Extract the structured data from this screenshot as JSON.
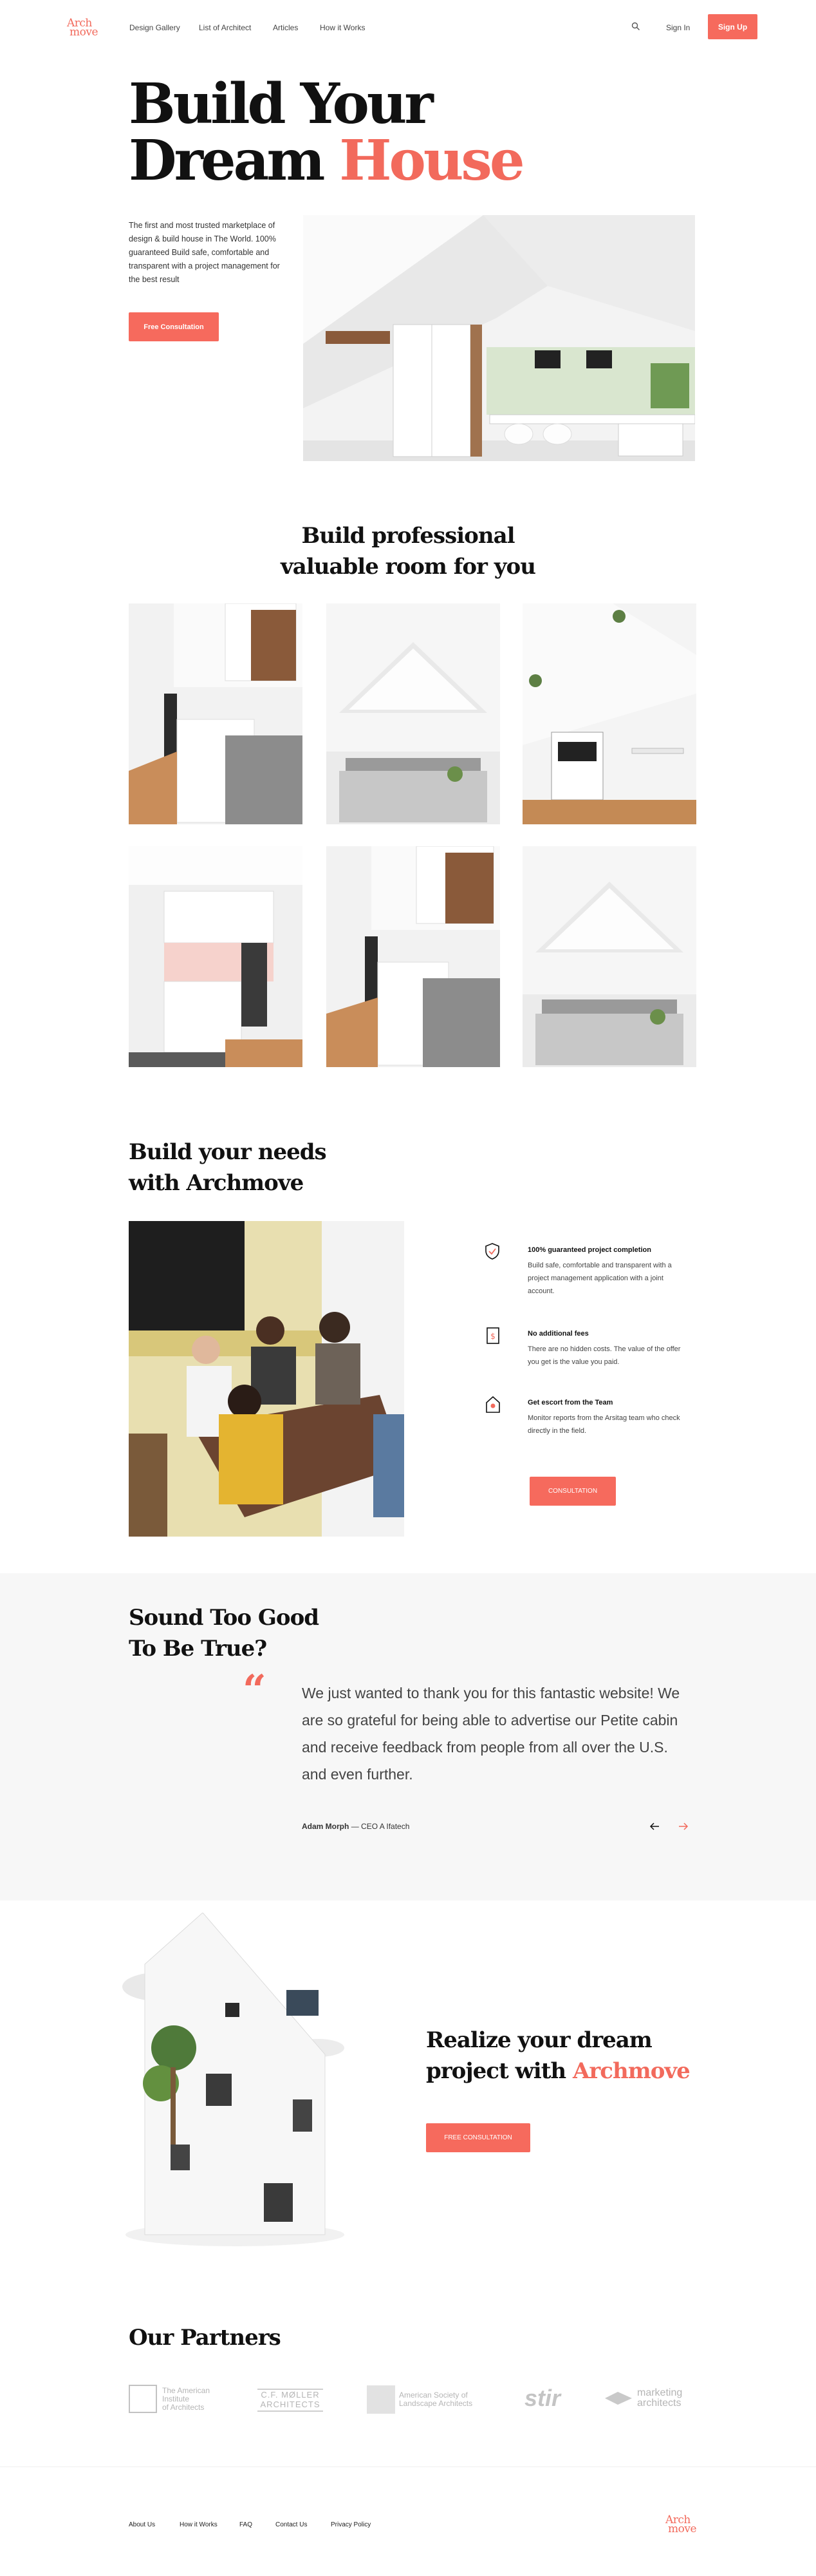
{
  "brand": {
    "logo_line1": "Arch",
    "logo_line2": "move",
    "accent_color": "#f26a5c",
    "button_color": "#f66a5d"
  },
  "nav": {
    "links": [
      "Design Gallery",
      "List of Architect",
      "Articles",
      "How it Works"
    ],
    "search_icon": "search-icon",
    "signin": "Sign In",
    "signup": "Sign Up"
  },
  "hero": {
    "title_line1": "Build Your",
    "title_line2_plain": "Dream",
    "title_line2_accent": "House",
    "description": "The first and most trusted marketplace of design & build house in The World. 100% guaranteed Build safe, comfortable and transparent with a project management for the best result",
    "cta": "Free Consultation"
  },
  "gallery": {
    "title_line1": "Build professional",
    "title_line2": "valuable room for you"
  },
  "needs": {
    "title_line1": "Build your needs",
    "title_line2": "with Archmove",
    "features": [
      {
        "icon": "shield-check-icon",
        "title": "100% guaranteed project completion",
        "text": "Build safe, comfortable and transparent with a project management application with a joint account."
      },
      {
        "icon": "price-tag-icon",
        "title": "No additional fees",
        "text": "There are no hidden costs. The value of the offer you get is the value you paid."
      },
      {
        "icon": "house-pin-icon",
        "title": "Get escort from the Team",
        "text": "Monitor reports from the Arsitag team who check directly in the field."
      }
    ],
    "cta": "CONSULTATION"
  },
  "testimonial": {
    "title_line1": "Sound Too Good",
    "title_line2": "To Be True?",
    "quote_icon": "quote-icon",
    "quote": "We just wanted to thank you for this fantastic website! We are so grateful for being able to advertise our Petite cabin and receive feedback from people from all over the U.S. and even further.",
    "author": "Adam Morph",
    "role": "— CEO A Ifatech",
    "prev_icon": "arrow-left-icon",
    "next_icon": "arrow-right-icon"
  },
  "realize": {
    "title_line1": "Realize your dream",
    "title_line2_plain": "project with",
    "title_line2_accent": "Archmove",
    "cta": "FREE CONSULTATION"
  },
  "partners": {
    "title": "Our Partners",
    "items": [
      {
        "line1": "The American",
        "line2": "Institute",
        "line3": "of Architects"
      },
      {
        "line1": "C.F. MØLLER",
        "line2": "ARCHITECTS"
      },
      {
        "line1": "American Society of",
        "line2": "Landscape Architects"
      },
      {
        "line1": "stir"
      },
      {
        "line1": "marketing",
        "line2": "architects"
      }
    ]
  },
  "footer": {
    "links": [
      "About Us",
      "How it Works",
      "FAQ",
      "Contact Us",
      "Privacy Policy"
    ],
    "logo_line1": "Arch",
    "logo_line2": "move"
  }
}
